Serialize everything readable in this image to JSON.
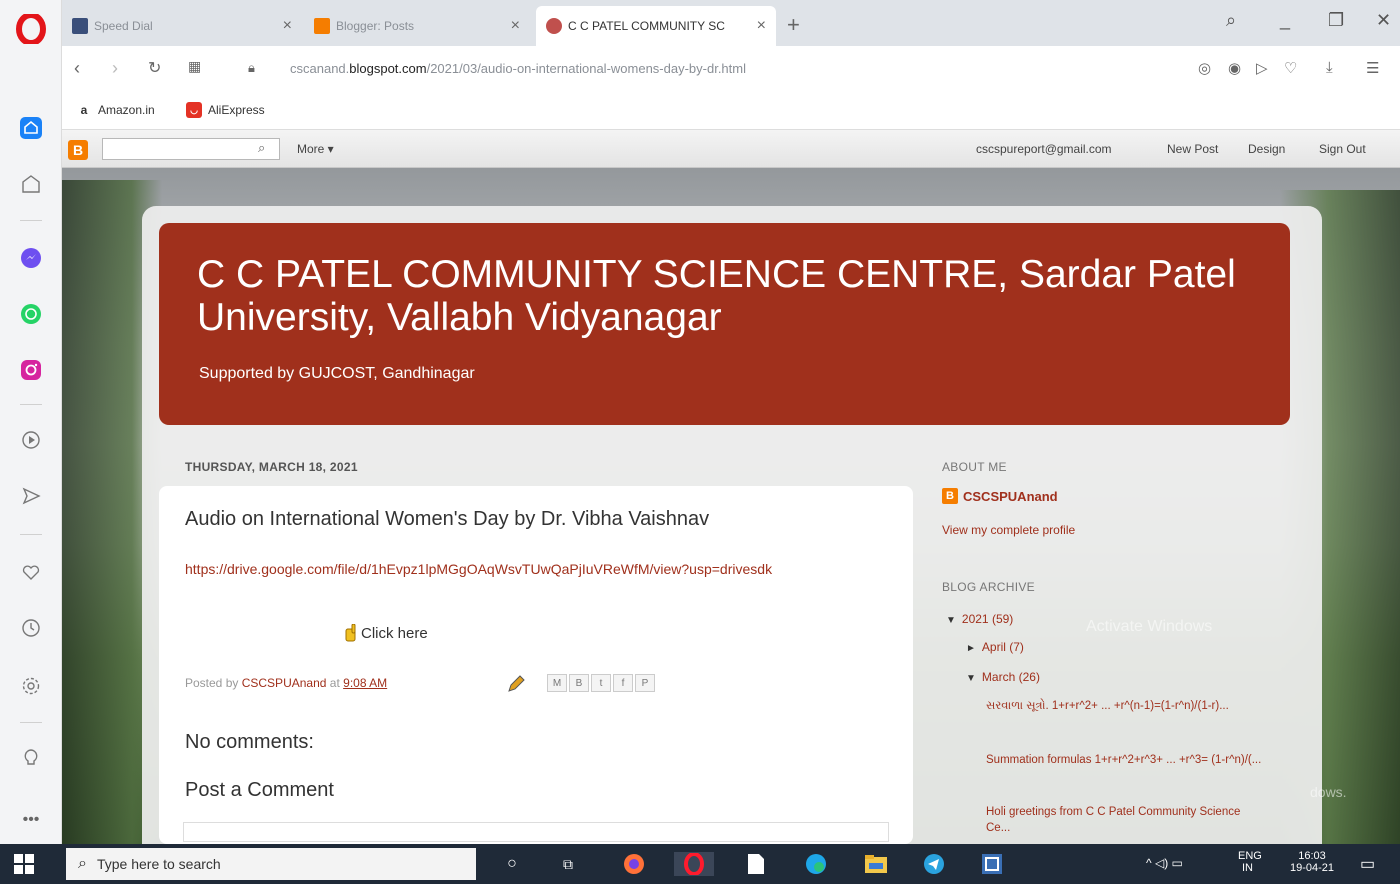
{
  "browser": {
    "tabs": [
      {
        "label": "Speed Dial",
        "icon": "grid-icon"
      },
      {
        "label": "Blogger: Posts",
        "icon": "blogger-icon"
      },
      {
        "label": "C C PATEL COMMUNITY SC",
        "icon": "site-favicon"
      }
    ],
    "url": {
      "prefix": "cscanand.",
      "domain": "blogspot.com",
      "path": "/2021/03/audio-on-international-womens-day-by-dr.html"
    },
    "bookmarks": [
      {
        "label": "Amazon.in",
        "icon": "amazon-icon"
      },
      {
        "label": "AliExpress",
        "icon": "aliexpress-icon"
      }
    ]
  },
  "blogger_navbar": {
    "search_placeholder": "",
    "more_label": "More ▾",
    "email": "cscspureport@gmail.com",
    "new_post": "New Post",
    "design": "Design",
    "sign_out": "Sign Out"
  },
  "blog": {
    "title": "C C PATEL COMMUNITY SCIENCE CENTRE, Sardar Patel University, Vallabh Vidyanagar",
    "description": "Supported by GUJCOST, Gandhinagar",
    "accent": "#a0301c"
  },
  "post": {
    "date": "THURSDAY, MARCH 18, 2021",
    "title": "Audio on International Women's Day by Dr. Vibha Vaishnav",
    "link": "https://drive.google.com/file/d/1hEvpz1lpMGgOAqWsvTUwQaPjIuVReWfM/view?usp=drivesdk",
    "click_here": "Click here",
    "posted_by": "Posted by",
    "author": "CSCSPUAnand",
    "at": "at",
    "time": "9:08 AM",
    "share_buttons": [
      "M",
      "B",
      "t",
      "f",
      "P"
    ],
    "no_comments": "No comments:",
    "post_a_comment": "Post a Comment"
  },
  "sidebar": {
    "about_me_title": "ABOUT ME",
    "profile_name": "CSCSPUAnand",
    "view_profile": "View my complete profile",
    "archive_title": "BLOG ARCHIVE",
    "archive": {
      "year": "2021",
      "year_count": "(59)",
      "april": "April",
      "april_count": "(7)",
      "march": "March",
      "march_count": "(26)",
      "posts": [
        "સરવાળા સૂત્રો. 1+r+r^2+ ... +r^(n-1)=(1-r^n)/(1-r)...",
        "Summation formulas 1+r+r^2+r^3+ ... +r^3= (1-r^n)/(...",
        "Holi greetings from C C Patel Community Science Ce..."
      ]
    }
  },
  "watermark": {
    "line1": "Activate Windows",
    "line2": "dows."
  },
  "taskbar": {
    "search_placeholder": "Type here to search",
    "lang1": "ENG",
    "lang2": "IN",
    "time": "16:03",
    "date": "19-04-21"
  }
}
